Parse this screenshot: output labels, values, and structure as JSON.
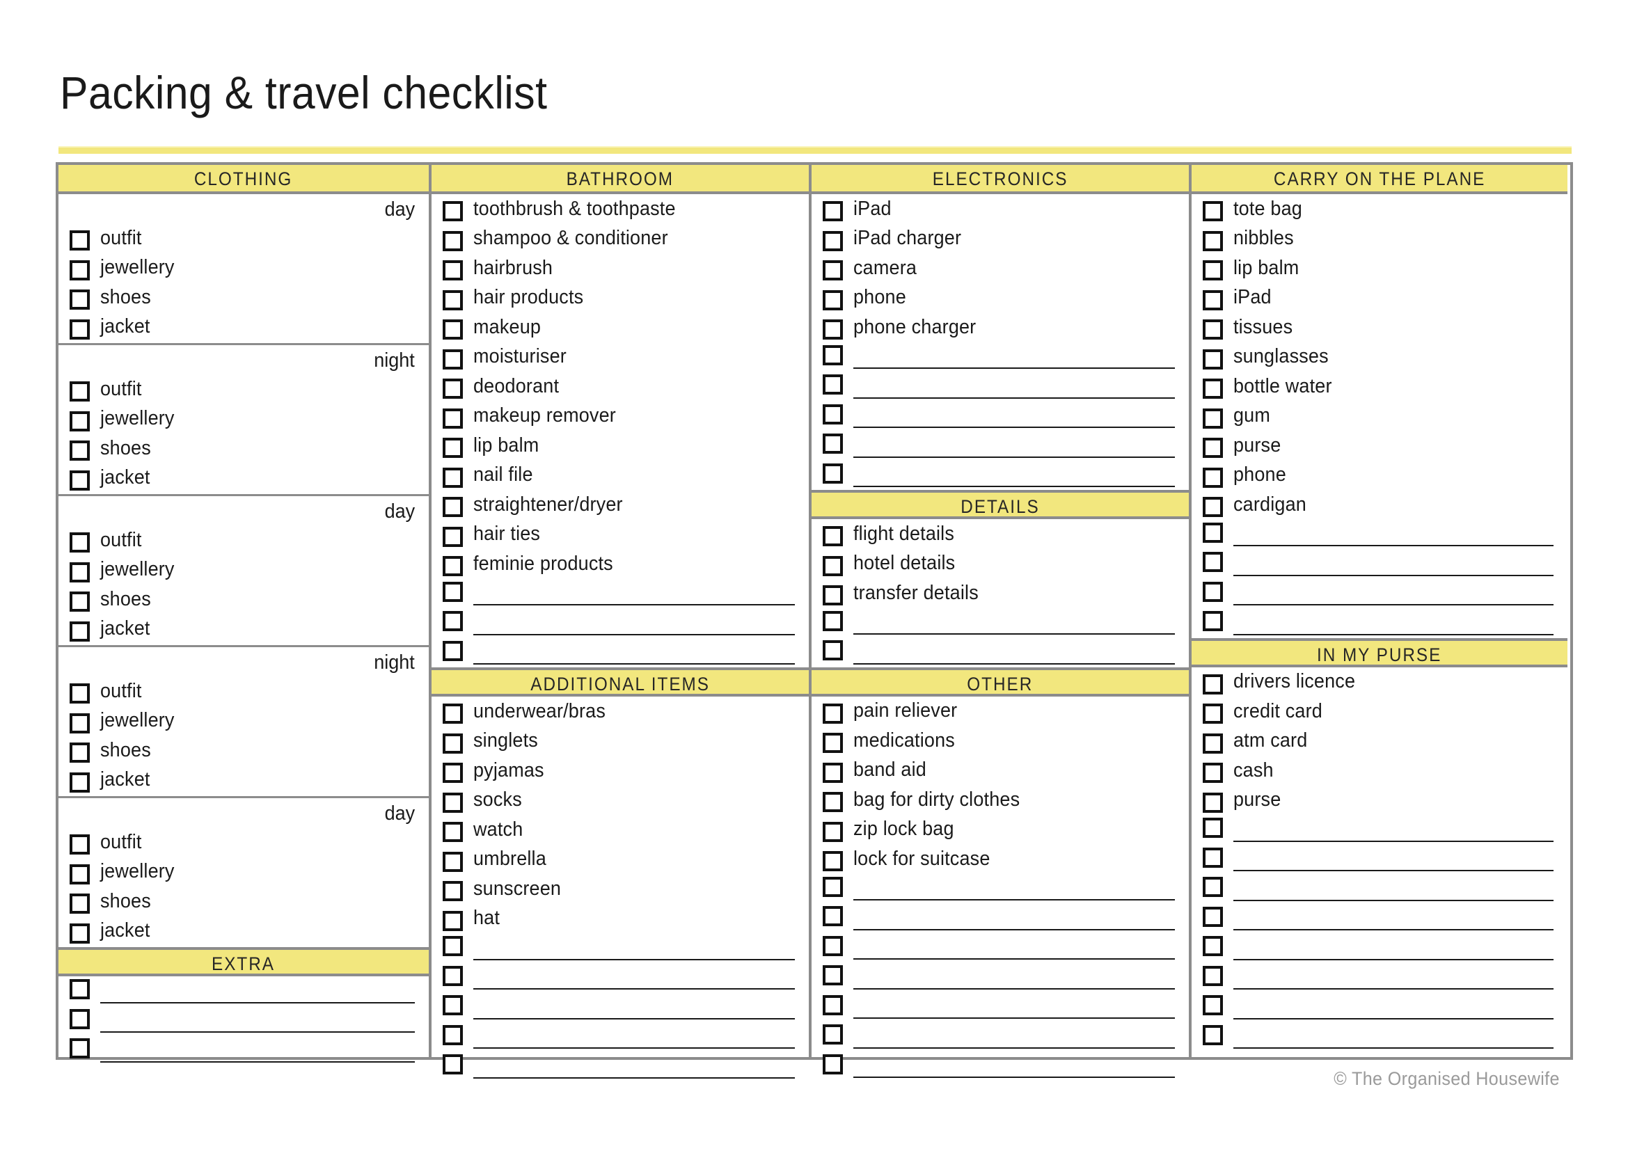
{
  "page": {
    "title": "Packing & travel checklist",
    "credit": "© The Organised Housewife",
    "accent_color": "#f2e77e",
    "border_color": "#8c8c8c"
  },
  "columns": {
    "clothing": {
      "header": "CLOTHING",
      "blocks": [
        {
          "period": "day",
          "items": [
            "outfit",
            "jewellery",
            "shoes",
            "jacket"
          ]
        },
        {
          "period": "night",
          "items": [
            "outfit",
            "jewellery",
            "shoes",
            "jacket"
          ]
        },
        {
          "period": "day",
          "items": [
            "outfit",
            "jewellery",
            "shoes",
            "jacket"
          ]
        },
        {
          "period": "night",
          "items": [
            "outfit",
            "jewellery",
            "shoes",
            "jacket"
          ]
        },
        {
          "period": "day",
          "items": [
            "outfit",
            "jewellery",
            "shoes",
            "jacket"
          ]
        }
      ],
      "extra": {
        "header": "EXTRA",
        "blank_rows": 3
      }
    },
    "bathroom": {
      "header": "BATHROOM",
      "items": [
        "toothbrush & toothpaste",
        "shampoo & conditioner",
        "hairbrush",
        "hair products",
        "makeup",
        "moisturiser",
        "deodorant",
        "makeup remover",
        "lip balm",
        "nail file",
        "straightener/dryer",
        "hair ties",
        "feminie products"
      ],
      "blank_rows": 3
    },
    "additional_items": {
      "header": "ADDITIONAL ITEMS",
      "items": [
        "underwear/bras",
        "singlets",
        "pyjamas",
        "socks",
        "watch",
        "umbrella",
        "sunscreen",
        "hat"
      ],
      "blank_rows": 5
    },
    "electronics": {
      "header": "ELECTRONICS",
      "items": [
        "iPad",
        "iPad charger",
        "camera",
        "phone",
        "phone charger"
      ],
      "blank_rows": 5
    },
    "details": {
      "header": "DETAILS",
      "items": [
        "flight details",
        "hotel details",
        "transfer details"
      ],
      "blank_rows": 2
    },
    "other": {
      "header": "OTHER",
      "items": [
        "pain reliever",
        "medications",
        "band aid",
        "bag for dirty clothes",
        "zip lock bag",
        "lock for suitcase"
      ],
      "blank_rows": 7
    },
    "carry_on": {
      "header": "CARRY ON THE PLANE",
      "items": [
        "tote bag",
        "nibbles",
        "lip balm",
        "iPad",
        "tissues",
        "sunglasses",
        "bottle water",
        "gum",
        "purse",
        "phone",
        "cardigan"
      ],
      "blank_rows": 4
    },
    "in_my_purse": {
      "header": "IN MY PURSE",
      "items": [
        "drivers licence",
        "credit card",
        "atm card",
        "cash",
        "purse"
      ],
      "blank_rows": 8
    }
  },
  "icons": {
    "checkbox": "checkbox-icon"
  }
}
